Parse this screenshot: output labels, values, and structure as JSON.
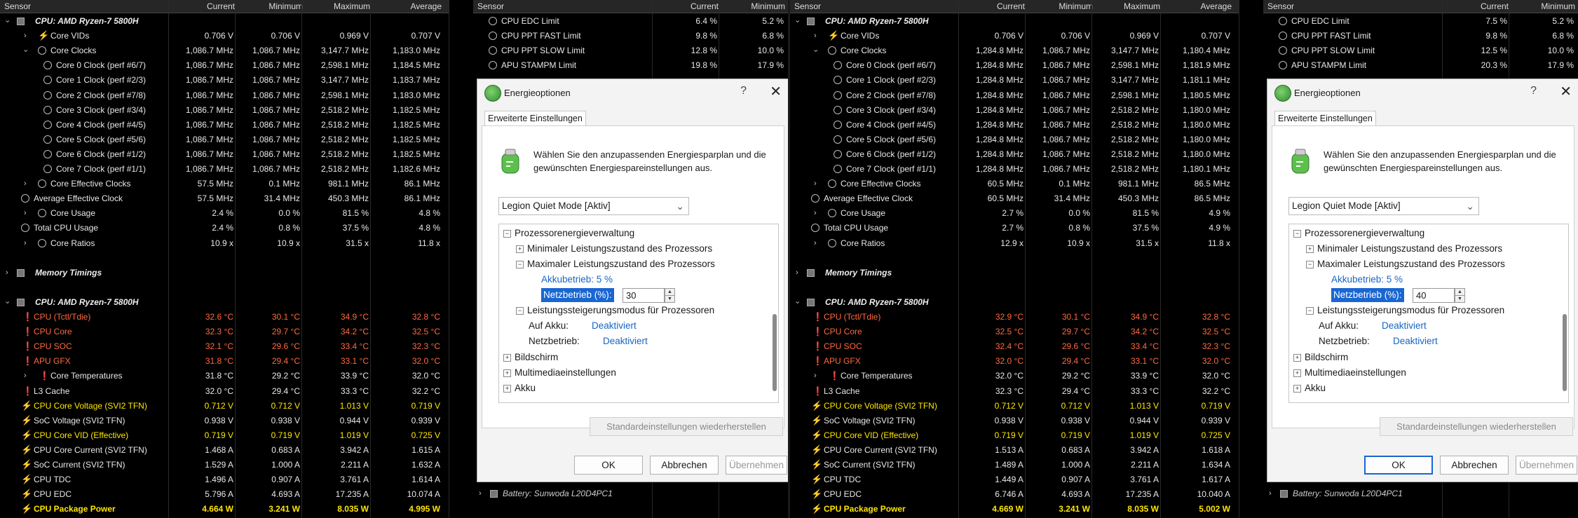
{
  "headers": {
    "sensor": "Sensor",
    "current": "Current",
    "minimum": "Minimum",
    "maximum": "Maximum",
    "average": "Average"
  },
  "left": {
    "main": [
      {
        "k": "sec",
        "t": "CPU: AMD Ryzen-7 5800H"
      },
      {
        "k": "bolt",
        "t": "Core VIDs",
        "c": "0.706 V",
        "n": "0.706 V",
        "x": "0.969 V",
        "a": "0.707 V",
        "lvl": 1,
        "exp": true
      },
      {
        "k": "o",
        "t": "Core Clocks",
        "c": "1,086.7 MHz",
        "n": "1,086.7 MHz",
        "x": "3,147.7 MHz",
        "a": "1,183.0 MHz",
        "lvl": 1,
        "exp": true,
        "open": true
      },
      {
        "k": "o",
        "t": "Core 0 Clock (perf #6/7)",
        "c": "1,086.7 MHz",
        "n": "1,086.7 MHz",
        "x": "2,598.1 MHz",
        "a": "1,184.5 MHz",
        "lvl": 2
      },
      {
        "k": "o",
        "t": "Core 1 Clock (perf #2/3)",
        "c": "1,086.7 MHz",
        "n": "1,086.7 MHz",
        "x": "3,147.7 MHz",
        "a": "1,183.7 MHz",
        "lvl": 2
      },
      {
        "k": "o",
        "t": "Core 2 Clock (perf #7/8)",
        "c": "1,086.7 MHz",
        "n": "1,086.7 MHz",
        "x": "2,598.1 MHz",
        "a": "1,183.0 MHz",
        "lvl": 2
      },
      {
        "k": "o",
        "t": "Core 3 Clock (perf #3/4)",
        "c": "1,086.7 MHz",
        "n": "1,086.7 MHz",
        "x": "2,518.2 MHz",
        "a": "1,182.5 MHz",
        "lvl": 2
      },
      {
        "k": "o",
        "t": "Core 4 Clock (perf #4/5)",
        "c": "1,086.7 MHz",
        "n": "1,086.7 MHz",
        "x": "2,518.2 MHz",
        "a": "1,182.5 MHz",
        "lvl": 2
      },
      {
        "k": "o",
        "t": "Core 5 Clock (perf #5/6)",
        "c": "1,086.7 MHz",
        "n": "1,086.7 MHz",
        "x": "2,518.2 MHz",
        "a": "1,182.5 MHz",
        "lvl": 2
      },
      {
        "k": "o",
        "t": "Core 6 Clock (perf #1/2)",
        "c": "1,086.7 MHz",
        "n": "1,086.7 MHz",
        "x": "2,518.2 MHz",
        "a": "1,182.5 MHz",
        "lvl": 2
      },
      {
        "k": "o",
        "t": "Core 7 Clock (perf #1/1)",
        "c": "1,086.7 MHz",
        "n": "1,086.7 MHz",
        "x": "2,518.2 MHz",
        "a": "1,182.6 MHz",
        "lvl": 2
      },
      {
        "k": "o",
        "t": "Core Effective Clocks",
        "c": "57.5 MHz",
        "n": "0.1 MHz",
        "x": "981.1 MHz",
        "a": "86.1 MHz",
        "lvl": 1,
        "exp": true
      },
      {
        "k": "o",
        "t": "Average Effective Clock",
        "c": "57.5 MHz",
        "n": "31.4 MHz",
        "x": "450.3 MHz",
        "a": "86.1 MHz",
        "lvl": 0
      },
      {
        "k": "o",
        "t": "Core Usage",
        "c": "2.4 %",
        "n": "0.0 %",
        "x": "81.5 %",
        "a": "4.8 %",
        "lvl": 1,
        "exp": true
      },
      {
        "k": "o",
        "t": "Total CPU Usage",
        "c": "2.4 %",
        "n": "0.8 %",
        "x": "37.5 %",
        "a": "4.8 %",
        "lvl": 0
      },
      {
        "k": "o",
        "t": "Core Ratios",
        "c": "10.9 x",
        "n": "10.9 x",
        "x": "31.5 x",
        "a": "11.8 x",
        "lvl": 1,
        "exp": true
      },
      {
        "k": "blank"
      },
      {
        "k": "sec",
        "t": "Memory Timings",
        "collapsed": true
      },
      {
        "k": "blank"
      },
      {
        "k": "sec",
        "t": "CPU: AMD Ryzen-7 5800H"
      },
      {
        "k": "th",
        "t": "CPU (Tctl/Tdie)",
        "c": "32.6 °C",
        "n": "30.1 °C",
        "x": "34.9 °C",
        "a": "32.8 °C",
        "col": "orange"
      },
      {
        "k": "th",
        "t": "CPU Core",
        "c": "32.3 °C",
        "n": "29.7 °C",
        "x": "34.2 °C",
        "a": "32.5 °C",
        "col": "orange"
      },
      {
        "k": "th",
        "t": "CPU SOC",
        "c": "32.1 °C",
        "n": "29.6 °C",
        "x": "33.4 °C",
        "a": "32.3 °C",
        "col": "orange"
      },
      {
        "k": "th",
        "t": "APU GFX",
        "c": "31.8 °C",
        "n": "29.4 °C",
        "x": "33.1 °C",
        "a": "32.0 °C",
        "col": "orange"
      },
      {
        "k": "th",
        "t": "Core Temperatures",
        "c": "31.8 °C",
        "n": "29.2 °C",
        "x": "33.9 °C",
        "a": "32.0 °C",
        "lvl": 1,
        "exp": true
      },
      {
        "k": "th",
        "t": "L3 Cache",
        "c": "32.0 °C",
        "n": "29.4 °C",
        "x": "33.3 °C",
        "a": "32.2 °C"
      },
      {
        "k": "bolt",
        "t": "CPU Core Voltage (SVI2 TFN)",
        "c": "0.712 V",
        "n": "0.712 V",
        "x": "1.013 V",
        "a": "0.719 V",
        "col": "yellow"
      },
      {
        "k": "bolt",
        "t": "SoC Voltage (SVI2 TFN)",
        "c": "0.938 V",
        "n": "0.938 V",
        "x": "0.944 V",
        "a": "0.939 V"
      },
      {
        "k": "bolt",
        "t": "CPU Core VID (Effective)",
        "c": "0.719 V",
        "n": "0.719 V",
        "x": "1.019 V",
        "a": "0.725 V",
        "col": "yellow"
      },
      {
        "k": "bolt",
        "t": "CPU Core Current (SVI2 TFN)",
        "c": "1.468 A",
        "n": "0.683 A",
        "x": "3.942 A",
        "a": "1.615 A"
      },
      {
        "k": "bolt",
        "t": "SoC Current (SVI2 TFN)",
        "c": "1.529 A",
        "n": "1.000 A",
        "x": "2.211 A",
        "a": "1.632 A"
      },
      {
        "k": "bolt",
        "t": "CPU TDC",
        "c": "1.496 A",
        "n": "0.907 A",
        "x": "3.761 A",
        "a": "1.614 A"
      },
      {
        "k": "bolt",
        "t": "CPU EDC",
        "c": "5.796 A",
        "n": "4.693 A",
        "x": "17.235 A",
        "a": "10.074 A"
      },
      {
        "k": "bolt",
        "t": "CPU Package Power",
        "c": "4.664 W",
        "n": "3.241 W",
        "x": "8.035 W",
        "a": "4.995 W",
        "col": "yellow",
        "bold": true
      }
    ],
    "right": [
      {
        "t": "CPU EDC Limit",
        "c": "6.4 %",
        "n": "5.2 %"
      },
      {
        "t": "CPU PPT FAST Limit",
        "c": "9.8 %",
        "n": "6.8 %"
      },
      {
        "t": "CPU PPT SLOW Limit",
        "c": "12.8 %",
        "n": "10.0 %"
      },
      {
        "t": "APU STAMPM Limit",
        "c": "19.8 %",
        "n": "17.9 %"
      }
    ],
    "netz_value": "30"
  },
  "right": {
    "main": [
      {
        "k": "sec",
        "t": "CPU: AMD Ryzen-7 5800H"
      },
      {
        "k": "bolt",
        "t": "Core VIDs",
        "c": "0.706 V",
        "n": "0.706 V",
        "x": "0.969 V",
        "a": "0.707 V",
        "lvl": 1,
        "exp": true
      },
      {
        "k": "o",
        "t": "Core Clocks",
        "c": "1,284.8 MHz",
        "n": "1,086.7 MHz",
        "x": "3,147.7 MHz",
        "a": "1,180.4 MHz",
        "lvl": 1,
        "exp": true,
        "open": true
      },
      {
        "k": "o",
        "t": "Core 0 Clock (perf #6/7)",
        "c": "1,284.8 MHz",
        "n": "1,086.7 MHz",
        "x": "2,598.1 MHz",
        "a": "1,181.9 MHz",
        "lvl": 2
      },
      {
        "k": "o",
        "t": "Core 1 Clock (perf #2/3)",
        "c": "1,284.8 MHz",
        "n": "1,086.7 MHz",
        "x": "3,147.7 MHz",
        "a": "1,181.1 MHz",
        "lvl": 2
      },
      {
        "k": "o",
        "t": "Core 2 Clock (perf #7/8)",
        "c": "1,284.8 MHz",
        "n": "1,086.7 MHz",
        "x": "2,598.1 MHz",
        "a": "1,180.5 MHz",
        "lvl": 2
      },
      {
        "k": "o",
        "t": "Core 3 Clock (perf #3/4)",
        "c": "1,284.8 MHz",
        "n": "1,086.7 MHz",
        "x": "2,518.2 MHz",
        "a": "1,180.0 MHz",
        "lvl": 2
      },
      {
        "k": "o",
        "t": "Core 4 Clock (perf #4/5)",
        "c": "1,284.8 MHz",
        "n": "1,086.7 MHz",
        "x": "2,518.2 MHz",
        "a": "1,180.0 MHz",
        "lvl": 2
      },
      {
        "k": "o",
        "t": "Core 5 Clock (perf #5/6)",
        "c": "1,284.8 MHz",
        "n": "1,086.7 MHz",
        "x": "2,518.2 MHz",
        "a": "1,180.0 MHz",
        "lvl": 2
      },
      {
        "k": "o",
        "t": "Core 6 Clock (perf #1/2)",
        "c": "1,284.8 MHz",
        "n": "1,086.7 MHz",
        "x": "2,518.2 MHz",
        "a": "1,180.0 MHz",
        "lvl": 2
      },
      {
        "k": "o",
        "t": "Core 7 Clock (perf #1/1)",
        "c": "1,284.8 MHz",
        "n": "1,086.7 MHz",
        "x": "2,518.2 MHz",
        "a": "1,180.1 MHz",
        "lvl": 2
      },
      {
        "k": "o",
        "t": "Core Effective Clocks",
        "c": "60.5 MHz",
        "n": "0.1 MHz",
        "x": "981.1 MHz",
        "a": "86.5 MHz",
        "lvl": 1,
        "exp": true
      },
      {
        "k": "o",
        "t": "Average Effective Clock",
        "c": "60.5 MHz",
        "n": "31.4 MHz",
        "x": "450.3 MHz",
        "a": "86.5 MHz",
        "lvl": 0
      },
      {
        "k": "o",
        "t": "Core Usage",
        "c": "2.7 %",
        "n": "0.0 %",
        "x": "81.5 %",
        "a": "4.9 %",
        "lvl": 1,
        "exp": true
      },
      {
        "k": "o",
        "t": "Total CPU Usage",
        "c": "2.7 %",
        "n": "0.8 %",
        "x": "37.5 %",
        "a": "4.9 %",
        "lvl": 0
      },
      {
        "k": "o",
        "t": "Core Ratios",
        "c": "12.9 x",
        "n": "10.9 x",
        "x": "31.5 x",
        "a": "11.8 x",
        "lvl": 1,
        "exp": true
      },
      {
        "k": "blank"
      },
      {
        "k": "sec",
        "t": "Memory Timings",
        "collapsed": true
      },
      {
        "k": "blank"
      },
      {
        "k": "sec",
        "t": "CPU: AMD Ryzen-7 5800H"
      },
      {
        "k": "th",
        "t": "CPU (Tctl/Tdie)",
        "c": "32.9 °C",
        "n": "30.1 °C",
        "x": "34.9 °C",
        "a": "32.8 °C",
        "col": "orange"
      },
      {
        "k": "th",
        "t": "CPU Core",
        "c": "32.5 °C",
        "n": "29.7 °C",
        "x": "34.2 °C",
        "a": "32.5 °C",
        "col": "orange"
      },
      {
        "k": "th",
        "t": "CPU SOC",
        "c": "32.4 °C",
        "n": "29.6 °C",
        "x": "33.4 °C",
        "a": "32.3 °C",
        "col": "orange"
      },
      {
        "k": "th",
        "t": "APU GFX",
        "c": "32.0 °C",
        "n": "29.4 °C",
        "x": "33.1 °C",
        "a": "32.0 °C",
        "col": "orange"
      },
      {
        "k": "th",
        "t": "Core Temperatures",
        "c": "32.0 °C",
        "n": "29.2 °C",
        "x": "33.9 °C",
        "a": "32.0 °C",
        "lvl": 1,
        "exp": true
      },
      {
        "k": "th",
        "t": "L3 Cache",
        "c": "32.3 °C",
        "n": "29.4 °C",
        "x": "33.3 °C",
        "a": "32.2 °C"
      },
      {
        "k": "bolt",
        "t": "CPU Core Voltage (SVI2 TFN)",
        "c": "0.712 V",
        "n": "0.712 V",
        "x": "1.013 V",
        "a": "0.719 V",
        "col": "yellow"
      },
      {
        "k": "bolt",
        "t": "SoC Voltage (SVI2 TFN)",
        "c": "0.938 V",
        "n": "0.938 V",
        "x": "0.944 V",
        "a": "0.939 V"
      },
      {
        "k": "bolt",
        "t": "CPU Core VID (Effective)",
        "c": "0.719 V",
        "n": "0.719 V",
        "x": "1.019 V",
        "a": "0.725 V",
        "col": "yellow"
      },
      {
        "k": "bolt",
        "t": "CPU Core Current (SVI2 TFN)",
        "c": "1.513 A",
        "n": "0.683 A",
        "x": "3.942 A",
        "a": "1.618 A"
      },
      {
        "k": "bolt",
        "t": "SoC Current (SVI2 TFN)",
        "c": "1.489 A",
        "n": "1.000 A",
        "x": "2.211 A",
        "a": "1.634 A"
      },
      {
        "k": "bolt",
        "t": "CPU TDC",
        "c": "1.449 A",
        "n": "0.907 A",
        "x": "3.761 A",
        "a": "1.617 A"
      },
      {
        "k": "bolt",
        "t": "CPU EDC",
        "c": "6.746 A",
        "n": "4.693 A",
        "x": "17.235 A",
        "a": "10.040 A"
      },
      {
        "k": "bolt",
        "t": "CPU Package Power",
        "c": "4.669 W",
        "n": "3.241 W",
        "x": "8.035 W",
        "a": "5.002 W",
        "col": "yellow",
        "bold": true
      }
    ],
    "right": [
      {
        "t": "CPU EDC Limit",
        "c": "7.5 %",
        "n": "5.2 %"
      },
      {
        "t": "CPU PPT FAST Limit",
        "c": "9.8 %",
        "n": "6.8 %"
      },
      {
        "t": "CPU PPT SLOW Limit",
        "c": "12.5 %",
        "n": "10.0 %"
      },
      {
        "t": "APU STAMPM Limit",
        "c": "20.3 %",
        "n": "17.9 %"
      }
    ],
    "netz_value": "40"
  },
  "battery": "Battery: Sunwoda L20D4PC1",
  "dialog": {
    "title": "Energieoptionen",
    "help": "?",
    "close": "✕",
    "tab": "Erweiterte Einstellungen",
    "intro": "Wählen Sie den anzupassenden Energiesparplan und die gewünschten Energiespareinstellungen aus.",
    "plan": "Legion Quiet Mode [Aktiv]",
    "tree": {
      "root": "Prozessorenergieverwaltung",
      "min": "Minimaler Leistungszustand des Prozessors",
      "max": "Maximaler Leistungszustand des Prozessors",
      "akku_label": "Akkubetrieb: 5 %",
      "netz_label": "Netzbetrieb (%):",
      "boost": "Leistungssteigerungsmodus für Prozessoren",
      "auf_akku": "Auf Akku:",
      "netzbetrieb": "Netzbetrieb:",
      "deakt": "Deaktiviert",
      "bild": "Bildschirm",
      "multi": "Multimediaeinstellungen",
      "akku": "Akku"
    },
    "restore": "Standardeinstellungen wiederherstellen",
    "ok": "OK",
    "cancel": "Abbrechen",
    "apply": "Übernehmen"
  }
}
